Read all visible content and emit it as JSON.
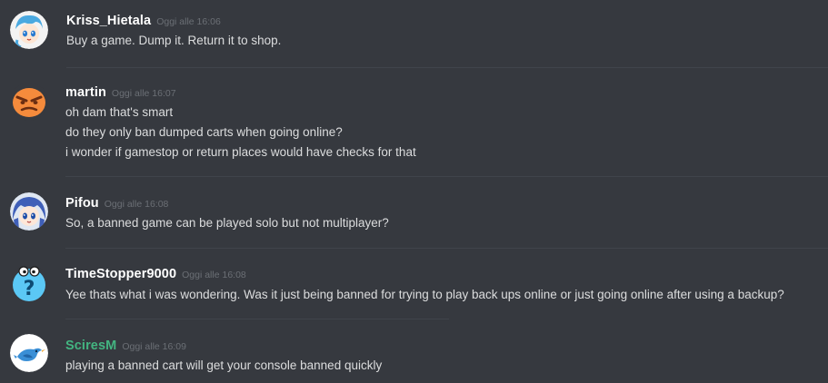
{
  "messages": [
    {
      "username": "Kriss_Hietala",
      "username_color": "#ffffff",
      "timestamp": "Oggi alle 16:06",
      "avatar_icon": "anime-girl-avatar",
      "lines": [
        "Buy a game. Dump it. Return it to shop."
      ]
    },
    {
      "username": "martin",
      "username_color": "#ffffff",
      "timestamp": "Oggi alle 16:07",
      "avatar_icon": "angry-face-avatar",
      "lines": [
        "oh dam that's smart",
        "do they only ban dumped carts when going online?",
        "i wonder if gamestop or return places would have checks for that"
      ]
    },
    {
      "username": "Pifou",
      "username_color": "#ffffff",
      "timestamp": "Oggi alle 16:08",
      "avatar_icon": "anime-blue-hair-avatar",
      "lines": [
        "So, a banned game can be played solo but not multiplayer?"
      ]
    },
    {
      "username": "TimeStopper9000",
      "username_color": "#ffffff",
      "timestamp": "Oggi alle 16:08",
      "avatar_icon": "question-mark-avatar",
      "lines": [
        "Yee thats what i was wondering. Was it just being banned for trying to play back ups online or just going online after using a backup?"
      ]
    },
    {
      "username": "SciresM",
      "username_color": "#43b581",
      "timestamp": "Oggi alle 16:09",
      "avatar_icon": "bird-avatar",
      "lines": [
        "playing a banned cart will get your console banned quickly"
      ]
    }
  ]
}
